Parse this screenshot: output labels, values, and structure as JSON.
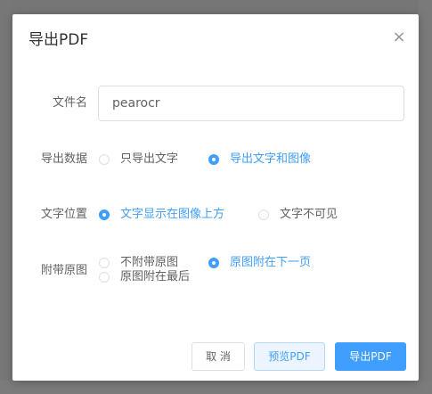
{
  "dialog": {
    "title": "导出PDF",
    "close_icon": "close-icon"
  },
  "filename": {
    "label": "文件名",
    "value": "pearocr"
  },
  "export_data": {
    "label": "导出数据",
    "options": [
      {
        "label": "只导出文字",
        "checked": false
      },
      {
        "label": "导出文字和图像",
        "checked": true
      }
    ]
  },
  "text_position": {
    "label": "文字位置",
    "options": [
      {
        "label": "文字显示在图像上方",
        "checked": true
      },
      {
        "label": "文字不可见",
        "checked": false
      }
    ]
  },
  "attach_original": {
    "label": "附带原图",
    "options": [
      {
        "label": "不附带原图",
        "checked": false
      },
      {
        "label": "原图附在下一页",
        "checked": true
      },
      {
        "label": "原图附在最后",
        "checked": false
      }
    ]
  },
  "buttons": {
    "cancel": "取 消",
    "preview": "预览PDF",
    "export": "导出PDF"
  },
  "colors": {
    "accent": "#409eff"
  }
}
